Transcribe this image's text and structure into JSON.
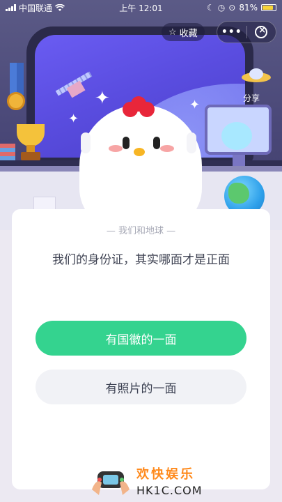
{
  "status_bar": {
    "carrier": "中国联通",
    "time": "上午 12:01",
    "battery_percent": "81%",
    "battery_level": 0.81
  },
  "header": {
    "favorite_label": "收藏",
    "share_label": "分享"
  },
  "quiz": {
    "category": "— 我们和地球 —",
    "question": "我们的身份证，其实哪面才是正面",
    "options": [
      {
        "label": "有国徽的一面",
        "color": "#34d38f"
      },
      {
        "label": "有照片的一面",
        "color": "#f1f2f6"
      }
    ]
  },
  "watermark": {
    "title": "欢快娱乐",
    "url": "HK1C.COM"
  }
}
